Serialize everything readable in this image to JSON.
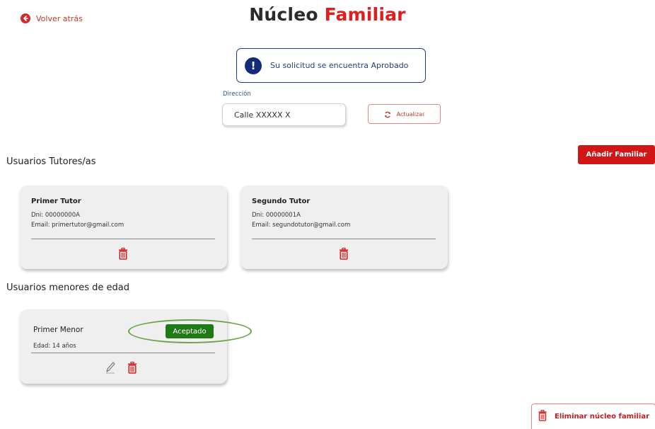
{
  "header": {
    "back_label": "Volver atrás",
    "title_part1": "Núcleo",
    "title_part2": "Familiar"
  },
  "notice": {
    "text": "Su solicitud se encuentra Aprobado",
    "icon": "exclamation-icon"
  },
  "address": {
    "label": "Dirección",
    "value": "Calle XXXXX X",
    "update_label": "Actualizar"
  },
  "actions": {
    "add_family_label": "Añadir Familiar",
    "delete_nucleus_label": "Eliminar núcleo familiar"
  },
  "tutors": {
    "section_title": "Usuarios Tutores/as",
    "items": [
      {
        "name": "Primer Tutor",
        "dni": "Dni: 00000000A",
        "email": "Email: primertutor@gmail.com"
      },
      {
        "name": "Segundo Tutor",
        "dni": "Dni: 00000001A",
        "email": "Email: segundotutor@gmail.com"
      }
    ]
  },
  "minors": {
    "section_title": "Usuarios menores de edad",
    "items": [
      {
        "name": "Primer Menor",
        "age": "Edad: 14 años",
        "status": "Aceptado"
      }
    ]
  },
  "colors": {
    "brand_red": "#e01e1e",
    "notice_blue": "#1f3b8a",
    "status_green": "#1f7a16",
    "highlight_green": "#6ba34a"
  }
}
